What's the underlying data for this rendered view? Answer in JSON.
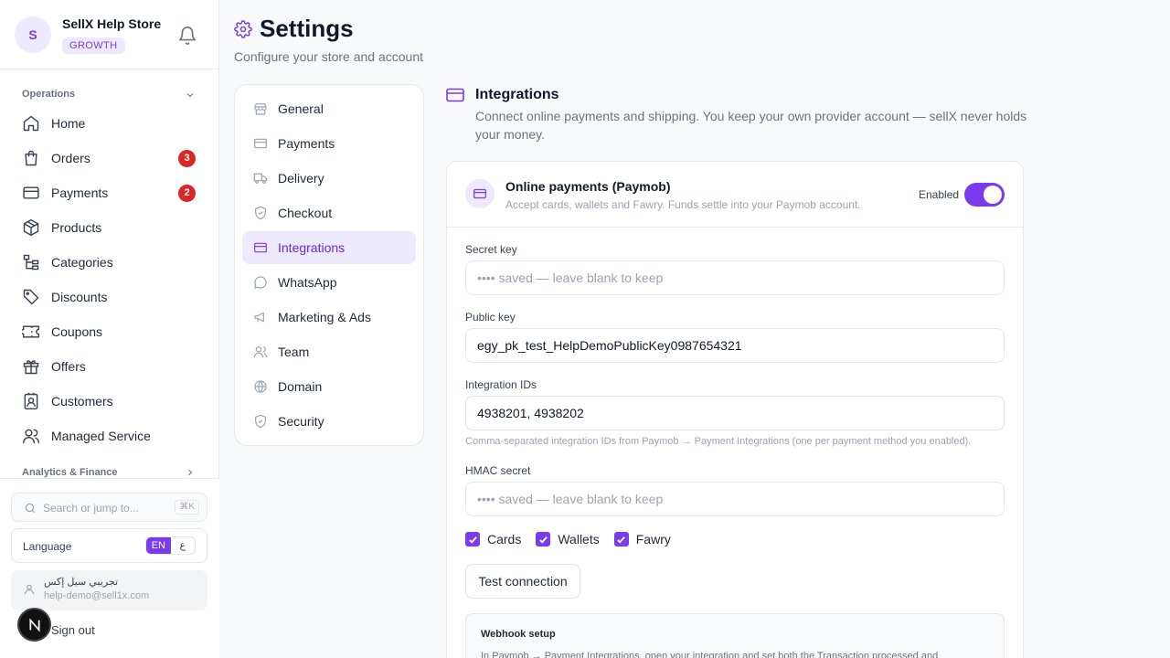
{
  "store": {
    "initial": "S",
    "name": "SellX Help Store",
    "plan": "GROWTH"
  },
  "sidebar": {
    "operations_label": "Operations",
    "items": [
      {
        "label": "Home",
        "icon": "home-icon"
      },
      {
        "label": "Orders",
        "icon": "bag-icon",
        "badge": "3"
      },
      {
        "label": "Payments",
        "icon": "card-icon",
        "badge": "2"
      },
      {
        "label": "Products",
        "icon": "box-icon"
      },
      {
        "label": "Categories",
        "icon": "tree-icon"
      },
      {
        "label": "Discounts",
        "icon": "tag-icon"
      },
      {
        "label": "Coupons",
        "icon": "ticket-icon"
      },
      {
        "label": "Offers",
        "icon": "gift-icon"
      },
      {
        "label": "Customers",
        "icon": "contact-icon"
      },
      {
        "label": "Managed Service",
        "icon": "users-icon"
      }
    ],
    "analytics_label": "Analytics & Finance",
    "search_placeholder": "Search or jump to...",
    "search_shortcut": "⌘K",
    "language_label": "Language",
    "lang_en": "EN",
    "lang_ar": "ع",
    "user_name": "تجريبي سيل إكس",
    "user_email": "help-demo@sell1x.com",
    "signout": "Sign out",
    "assistant_letter": "N"
  },
  "page": {
    "title": "Settings",
    "subtitle": "Configure your store and account"
  },
  "settings_nav": [
    {
      "label": "General",
      "icon": "store-icon"
    },
    {
      "label": "Payments",
      "icon": "card-icon"
    },
    {
      "label": "Delivery",
      "icon": "truck-icon"
    },
    {
      "label": "Checkout",
      "icon": "shield-check-icon"
    },
    {
      "label": "Integrations",
      "icon": "card-icon",
      "active": true
    },
    {
      "label": "WhatsApp",
      "icon": "chat-icon"
    },
    {
      "label": "Marketing & Ads",
      "icon": "megaphone-icon"
    },
    {
      "label": "Team",
      "icon": "users-icon"
    },
    {
      "label": "Domain",
      "icon": "globe-icon"
    },
    {
      "label": "Security",
      "icon": "shield-icon"
    }
  ],
  "section": {
    "title": "Integrations",
    "description": "Connect online payments and shipping. You keep your own provider account — sellX never holds your money."
  },
  "paymob": {
    "title": "Online payments (Paymob)",
    "subtitle": "Accept cards, wallets and Fawry. Funds settle into your Paymob account.",
    "enabled_label": "Enabled",
    "enabled": true,
    "secret_key_label": "Secret key",
    "secret_key_placeholder": "•••• saved — leave blank to keep",
    "public_key_label": "Public key",
    "public_key_value": "egy_pk_test_HelpDemoPublicKey0987654321",
    "integration_ids_label": "Integration IDs",
    "integration_ids_value": "4938201, 4938202",
    "integration_ids_help": "Comma-separated integration IDs from Paymob → Payment Integrations (one per payment method you enabled).",
    "hmac_label": "HMAC secret",
    "hmac_placeholder": "•••• saved — leave blank to keep",
    "methods": [
      {
        "label": "Cards",
        "checked": true
      },
      {
        "label": "Wallets",
        "checked": true
      },
      {
        "label": "Fawry",
        "checked": true
      }
    ],
    "test_button": "Test connection",
    "webhook_title": "Webhook setup",
    "webhook_text": "In Paymob → Payment Integrations, open your integration and set both the Transaction processed and"
  },
  "colors": {
    "accent": "#7c3aed",
    "accent_light": "#ede9fe",
    "badge_red": "#dc2626"
  }
}
